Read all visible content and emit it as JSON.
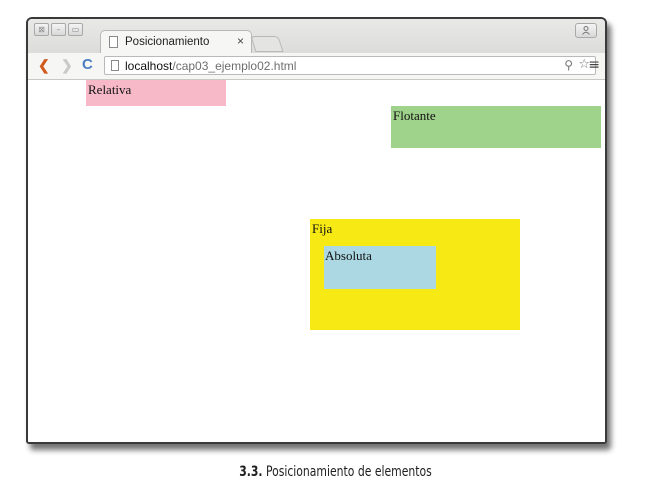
{
  "browser": {
    "tab_title": "Posicionamiento",
    "tab_close": "×",
    "window_buttons": [
      "⊠",
      "–",
      "▭"
    ],
    "profile_icon": "person-icon",
    "address": {
      "host": "localhost",
      "path": "/cap03_ejemplo02.html"
    },
    "icons": {
      "back": "❮",
      "forward": "❯",
      "reload": "C",
      "zoom": "⚲",
      "star": "☆",
      "menu": "≡"
    }
  },
  "page": {
    "relativa": "Relativa",
    "flotante": "Flotante",
    "fija": "Fija",
    "absoluta": "Absoluta"
  },
  "colors": {
    "relativa": "#f7b9c8",
    "flotante": "#9fd28a",
    "fija": "#f6e914",
    "absoluta": "#acd8e4"
  },
  "caption": {
    "number": "3.3.",
    "text": "Posicionamiento de elementos"
  }
}
